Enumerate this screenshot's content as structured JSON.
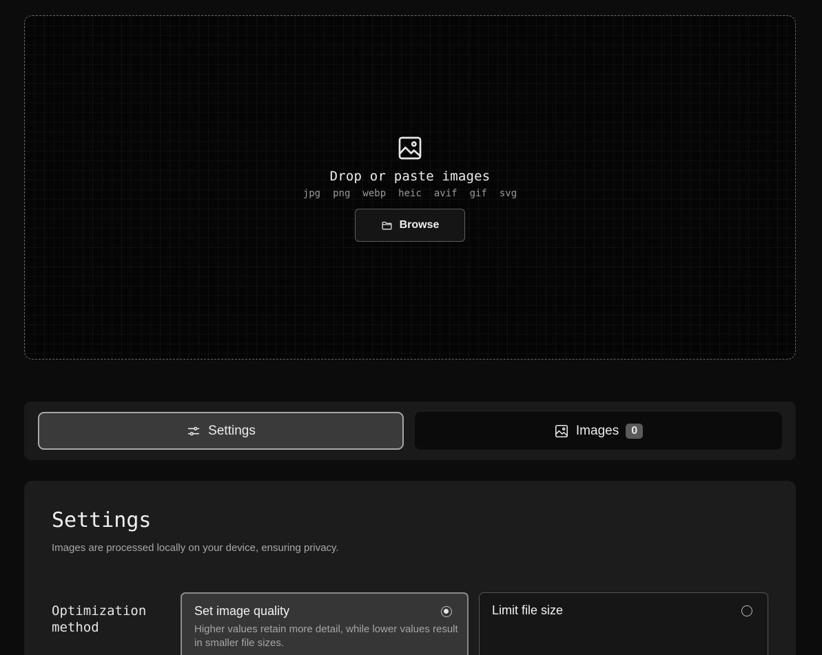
{
  "dropzone": {
    "icon": "image-icon",
    "title": "Drop or paste images",
    "formats": [
      "jpg",
      "png",
      "webp",
      "heic",
      "avif",
      "gif",
      "svg"
    ],
    "browse_icon": "folder-icon",
    "browse_label": "Browse"
  },
  "tabs": {
    "settings": {
      "icon": "sliders-icon",
      "label": "Settings",
      "active": true
    },
    "images": {
      "icon": "image-icon",
      "label": "Images",
      "count": "0",
      "active": false
    }
  },
  "settings_panel": {
    "title": "Settings",
    "subtitle": "Images are processed locally on your device, ensuring privacy.",
    "optimization_label": "Optimization method",
    "options": [
      {
        "title": "Set image quality",
        "description": "Higher values retain more detail, while lower values result in smaller file sizes.",
        "selected": true
      },
      {
        "title": "Limit file size",
        "description": "",
        "selected": false
      }
    ]
  }
}
